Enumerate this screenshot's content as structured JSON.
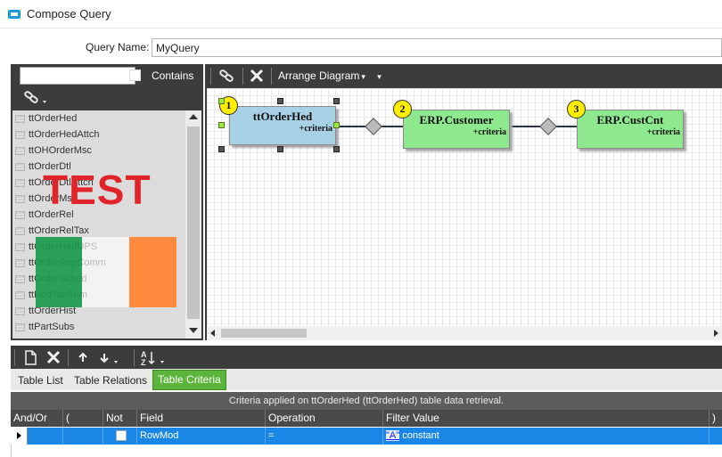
{
  "window": {
    "title": "Compose Query"
  },
  "query": {
    "name_label": "Query Name:",
    "name_value": "MyQuery"
  },
  "table_panel": {
    "filter_value": "",
    "contains_label": "Contains",
    "contains_checked": false,
    "tables": [
      "ttOrderHed",
      "ttOrderHedAttch",
      "ttOHOrderMsc",
      "ttOrderDtl",
      "ttOrderDtlAttch",
      "ttOrderMsc",
      "ttOrderRel",
      "ttOrderRelTax",
      "ttOrderHedUPS",
      "ttOrderRepComm",
      "ttOrderSched",
      "ttHedTaxSum",
      "ttOrderHist",
      "ttPartSubs"
    ]
  },
  "watermark": {
    "text": "TEST",
    "flag_colors": [
      "#1a9a4c",
      "#ffffff",
      "#ff8a3d"
    ]
  },
  "diagram": {
    "arrange_label": "Arrange Diagram",
    "nodes": [
      {
        "number": "1",
        "name": "ttOrderHed",
        "criteria": "+criteria",
        "color": "#a9d1e6",
        "selected": true
      },
      {
        "number": "2",
        "name": "ERP.Customer",
        "criteria": "+criteria",
        "color": "#8ee88e",
        "selected": false
      },
      {
        "number": "3",
        "name": "ERP.CustCnt",
        "criteria": "+criteria",
        "color": "#8ee88e",
        "selected": false
      }
    ]
  },
  "tabs": [
    {
      "label": "Table List",
      "active": false
    },
    {
      "label": "Table Relations",
      "active": false
    },
    {
      "label": "Table Criteria",
      "active": true
    }
  ],
  "criteria": {
    "banner": "Criteria applied on ttOrderHed (ttOrderHed)  table data retrieval.",
    "columns": [
      "And/Or",
      "(",
      "Not",
      "Field",
      "Operation",
      "Filter Value",
      ")"
    ],
    "rows": [
      {
        "and_or": "",
        "open_paren": "",
        "not": false,
        "field": "RowMod",
        "operation": "=",
        "filter_link": "\"A\"",
        "filter_type": "constant",
        "close_paren": ""
      }
    ]
  },
  "colors": {
    "accent_tab": "#5ab53a",
    "selected_row": "#1a86e6",
    "dark_panel": "#3c3c3c"
  }
}
